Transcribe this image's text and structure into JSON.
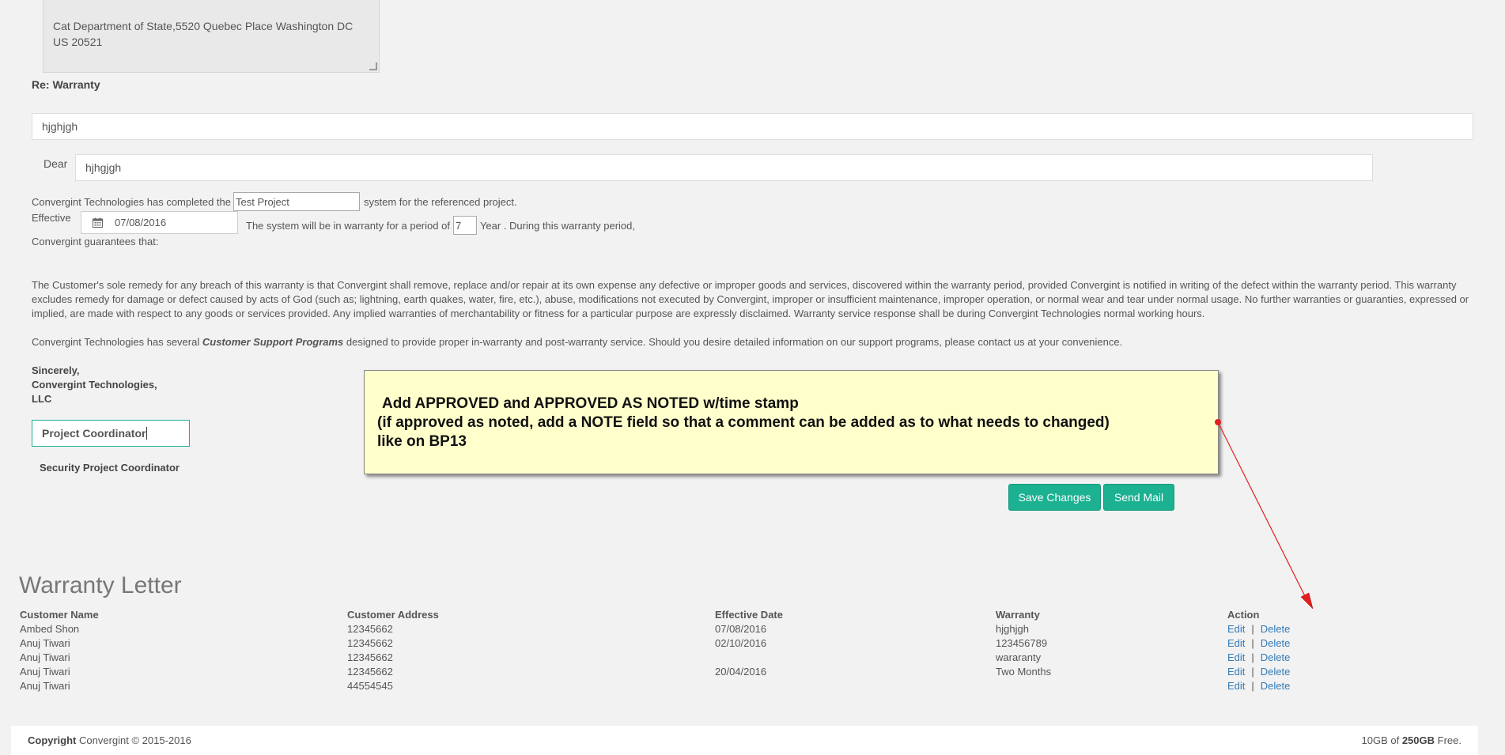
{
  "address": "Cat Department of State,5520 Quebec Place Washington DC US 20521",
  "re_label": "Re: Warranty",
  "re_value": "hjghjgh",
  "dear_label": "Dear",
  "dear_value": "hjhgjgh",
  "sentence1_pre": "Convergint Technologies has completed the",
  "project_value": "Test Project",
  "sentence1_post": "system for the referenced project.",
  "effective_label": "Effective",
  "effective_date": "07/08/2016",
  "period_pre": "The system will be in warranty for a period of",
  "period_value": "7",
  "period_post": "Year . During this warranty period,",
  "guarantees": "Convergint guarantees that:",
  "remedy_paragraph": "The Customer's sole remedy for any breach of this warranty is that Convergint shall remove, replace and/or repair at its own expense any defective or improper goods and services, discovered within the warranty period, provided Convergint is notified in writing of the defect within the warranty period. This warranty excludes remedy for damage or defect caused by acts of God (such as; lightning, earth quakes, water, fire, etc.), abuse, modifications not executed by Convergint, improper or insufficient maintenance, improper operation, or normal wear and tear under normal usage. No further warranties or guaranties, expressed or implied, are made with respect to any goods or services provided. Any implied warranties of merchantability or fitness for a particular purpose are expressly disclaimed. Warranty service response shall be during Convergint Technologies normal working hours.",
  "support_pre": "Convergint Technologies has several",
  "support_emph": "Customer Support Programs",
  "support_post": "designed to provide proper in-warranty and post-warranty service. Should you desire detailed information on our support programs, please contact us at your convenience.",
  "sincerely_1": "Sincerely,",
  "sincerely_2": "Convergint Technologies,",
  "sincerely_3": "LLC",
  "coordinator_value": "Project Coordinator",
  "coordinator_title": "Security Project Coordinator",
  "note_line1": "Add APPROVED and APPROVED AS NOTED w/time stamp",
  "note_line2": "(if approved as noted, add a NOTE field so that a comment can be added as to what needs to changed)",
  "note_line3": "like on BP13",
  "save_label": "Save Changes",
  "send_label": "Send Mail",
  "section_title": "Warranty Letter",
  "table": {
    "headers": [
      "Customer Name",
      "Customer Address",
      "Effective Date",
      "Warranty",
      "Action"
    ],
    "rows": [
      [
        "Ambed Shon",
        "12345662",
        "07/08/2016",
        "hjghjgh"
      ],
      [
        "Anuj Tiwari",
        "12345662",
        "02/10/2016",
        "123456789"
      ],
      [
        "Anuj Tiwari",
        "12345662",
        "",
        "wararanty"
      ],
      [
        "Anuj Tiwari",
        "12345662",
        "20/04/2016",
        "Two Months"
      ],
      [
        "Anuj Tiwari",
        "44554545",
        "",
        ""
      ]
    ],
    "edit_label": "Edit",
    "delete_label": "Delete",
    "separator": "|"
  },
  "footer": {
    "copyright_label": "Copyright",
    "copyright_text": "Convergint © 2015-2016",
    "storage_used": "10GB of",
    "storage_total": "250GB",
    "storage_suffix": "Free."
  },
  "colors": {
    "accent": "#1bb191",
    "link": "#337ab7",
    "note_bg": "#ffffcc",
    "arrow": "#e02020"
  }
}
